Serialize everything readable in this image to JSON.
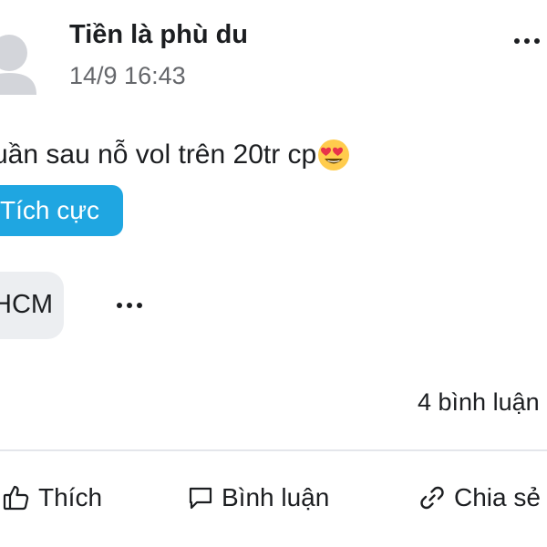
{
  "post": {
    "author": "Tiền là phù du",
    "timestamp": "14/9 16:43",
    "content": "uần sau nỗ vol trên 20tr cp",
    "emoji_icon": "heart-eyes-emoji",
    "sentiment_tag": "Tích cực",
    "location_chip": "HCM",
    "comment_count": "4 bình luận"
  },
  "actions": {
    "like_label": "Thích",
    "comment_label": "Bình luận",
    "share_label": "Chia sẻ"
  },
  "icons": {
    "more_top": "more-horizontal-icon",
    "more_chip": "more-horizontal-icon",
    "like": "thumbs-up-icon",
    "comment": "comment-bubble-icon",
    "share": "link-icon"
  },
  "colors": {
    "tag_background": "#1fa6e1",
    "chip_background": "#eceef1",
    "secondary_text": "#65676b",
    "divider": "#e4e6eb"
  }
}
